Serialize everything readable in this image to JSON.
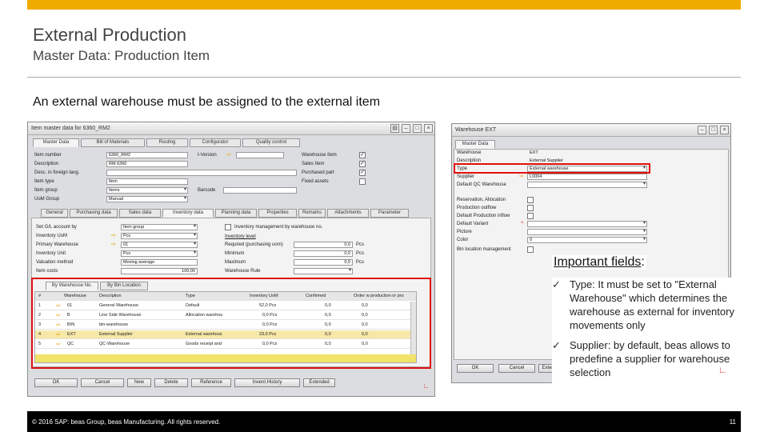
{
  "slide": {
    "title": "External Production",
    "subtitle": "Master Data: Production Item",
    "lead": "An external warehouse must be assigned to the external item",
    "footer": "© 2016 SAP: beas Group, beas Manufacturing. All rights reserved.",
    "page_number": "11",
    "accent_color": "#f0ab00",
    "highlight_color": "#e01010"
  },
  "item_window": {
    "title": "Item master data for 6360_RM2",
    "tabs": [
      "Master Data",
      "Bill of Materials",
      "Routing",
      "Configurator",
      "Quality control"
    ],
    "fields": [
      {
        "label": "Item number",
        "value": "6360_RM2"
      },
      {
        "label": "Description",
        "value": "RM 6360"
      },
      {
        "label": "Desc. in foreign lang.",
        "value": ""
      },
      {
        "label": "Item type",
        "value": "Item"
      },
      {
        "label": "Item group",
        "value": "Items"
      },
      {
        "label": "UoM Group",
        "value": "Manual"
      }
    ],
    "i_version_label": "I-Version",
    "barcode_label": "Barcode",
    "checks": [
      {
        "label": "Warehouse Item",
        "checked": true
      },
      {
        "label": "Sales Item",
        "checked": true
      },
      {
        "label": "Purchased part",
        "checked": true
      },
      {
        "label": "Fixed assets",
        "checked": false
      }
    ],
    "subtabs": [
      "General",
      "Purchasing data",
      "Sales data",
      "Inventory data",
      "Planning data",
      "Properties",
      "Remarks",
      "Attachments",
      "Parameter"
    ],
    "inv_left": [
      {
        "label": "Set G/L account by",
        "value": "Item group"
      },
      {
        "label": "Inventory UoM",
        "value": "Pcs"
      },
      {
        "label": "Primary Warehouse",
        "value": "01"
      },
      {
        "label": "Inventory Unit",
        "value": "Pcs"
      },
      {
        "label": "Valuation method",
        "value": "Moving average"
      },
      {
        "label": "Item costs",
        "value": "100,00"
      }
    ],
    "inv_right_check": "Inventory management by warehouse no.",
    "inventory_level": "Inventory level",
    "inv_right": [
      {
        "label": "Required (purchasing uom)",
        "value": "0,0",
        "unit": "Pcs"
      },
      {
        "label": "Minimum",
        "value": "0,0",
        "unit": "Pcs"
      },
      {
        "label": "Maximum",
        "value": "0,0",
        "unit": "Pcs"
      },
      {
        "label": "Warehouse Rule",
        "value": ""
      }
    ],
    "grid_tabs": [
      "By Warehouse No.",
      "By Bin Location"
    ],
    "grid_columns": [
      "#",
      "Warehouse",
      "Description",
      "Type",
      "Inventory UoM",
      "Confirmed",
      "Order w production or pro"
    ],
    "grid_rows": [
      [
        "1",
        "01",
        "General Warehouse",
        "Default",
        "52,0 Pcs",
        "0,0",
        "0,0"
      ],
      [
        "2",
        "B",
        "Line Side Warehouse",
        "Allocation warehou",
        "0,0 Pcs",
        "0,0",
        "0,0"
      ],
      [
        "3",
        "BIN",
        "bin-warehouse",
        "",
        "0,0 Pcs",
        "0,0",
        "0,0"
      ],
      [
        "4",
        "EXT",
        "External Supplier",
        "External warehous",
        "23,0 Pcs",
        "0,0",
        "0,0"
      ],
      [
        "5",
        "QC",
        "QC-Warehouse",
        "Goods receipt and",
        "0,0 Pcs",
        "0,0",
        "0,0"
      ]
    ],
    "buttons": [
      "OK",
      "Cancel",
      "New",
      "Delete",
      "Reference",
      "Invent.History",
      "Extended"
    ]
  },
  "wh_window": {
    "title": "Warehouse EXT",
    "tab": "Master Data",
    "fields": [
      {
        "label": "Warehouse",
        "value": "EXT"
      },
      {
        "label": "Description",
        "value": "External Supplier"
      },
      {
        "label": "Type",
        "value": "External warehouse"
      },
      {
        "label": "Supplier",
        "value": "L0004"
      },
      {
        "label": "Default QC Warehouse",
        "value": ""
      }
    ],
    "checks": [
      "Reservation, Allocation",
      "Production outflow",
      "Default Production inflow"
    ],
    "more": [
      {
        "label": "Default Variant",
        "value": ""
      },
      {
        "label": "Picture",
        "value": ""
      },
      {
        "label": "Color",
        "value": "0"
      },
      {
        "label": "Bin location management",
        "value": ""
      }
    ],
    "buttons": [
      "OK",
      "Cancel",
      "Extended"
    ]
  },
  "callout": {
    "heading": "Important fields",
    "colon": ":",
    "bullets": [
      "Type: It must be set to \"External Warehouse\" which determines the warehouse as external for inventory movements only",
      "Supplier: by default, beas allows to predefine a supplier for warehouse selection"
    ]
  }
}
